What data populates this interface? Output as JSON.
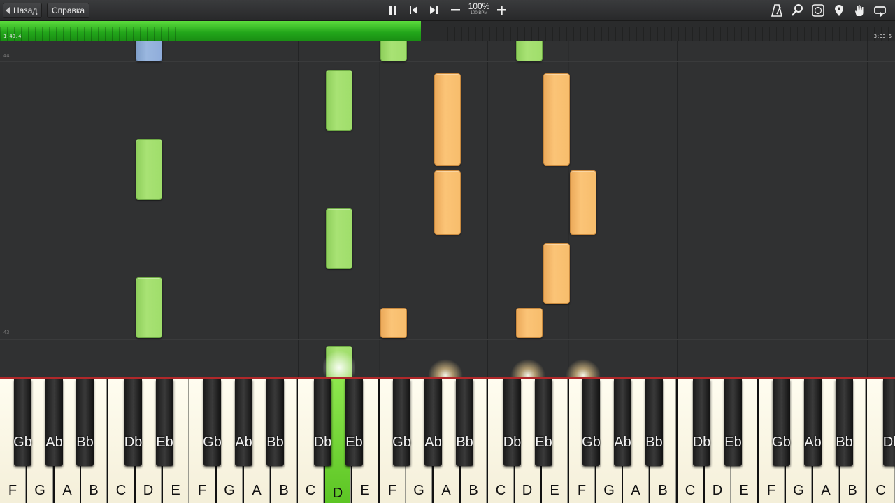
{
  "toolbar": {
    "back_label": "Назад",
    "help_label": "Справка",
    "tempo_percent": "100%",
    "tempo_bpm": "100 BPM",
    "icons": [
      "pause-icon",
      "skip-back-icon",
      "skip-forward-icon",
      "minus-icon",
      "plus-icon",
      "metronome-icon",
      "magnifier-icon",
      "note-label-icon",
      "location-pin-icon",
      "hand-icon",
      "loop-icon"
    ]
  },
  "progress": {
    "elapsed": "1:40.4",
    "total": "3:33.6",
    "fraction": 0.47,
    "fill_color": "#3cbf2a"
  },
  "roll": {
    "measures": [
      "44",
      "43"
    ],
    "colors": {
      "right_hand": "#a4e070",
      "left_hand": "#f8c070",
      "other": "#95b2dc"
    }
  },
  "keyboard": {
    "white_keys": [
      "F",
      "G",
      "A",
      "B",
      "C",
      "D",
      "E",
      "F",
      "G",
      "A",
      "B",
      "C",
      "D",
      "E",
      "F",
      "G",
      "A",
      "B",
      "C",
      "D",
      "E",
      "F",
      "G",
      "A",
      "B",
      "C",
      "D",
      "E",
      "F",
      "G",
      "A",
      "B",
      "C"
    ],
    "black_keys": [
      "Gb",
      "Ab",
      "Bb",
      "Db",
      "Eb",
      "Gb",
      "Ab",
      "Bb",
      "Db",
      "Eb",
      "Gb",
      "Ab",
      "Bb",
      "Db",
      "Eb",
      "Gb",
      "Ab",
      "Bb",
      "Db",
      "Eb",
      "Gb",
      "Ab",
      "Bb",
      "Db"
    ],
    "active_key": "D",
    "active_color": "#6fd43a"
  }
}
